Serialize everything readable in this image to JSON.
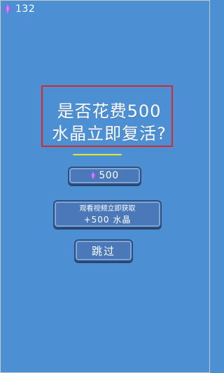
{
  "hud": {
    "crystal_count": "132",
    "crystal_icon": "purple-gem-icon"
  },
  "dialog": {
    "title_line1": "是否花费500",
    "title_line2": "水晶立即复活?",
    "highlight_color": "#d62a2a",
    "divider_color": "#e6e62a"
  },
  "buttons": {
    "pay": {
      "amount": "500"
    },
    "video": {
      "line1": "观看视频立即获取",
      "line2": "+500 水晶"
    },
    "skip": {
      "label": "跳过"
    }
  },
  "colors": {
    "background": "#4d8fd3",
    "button_fill": "#4a78b8",
    "gem": "#a05ce0"
  }
}
